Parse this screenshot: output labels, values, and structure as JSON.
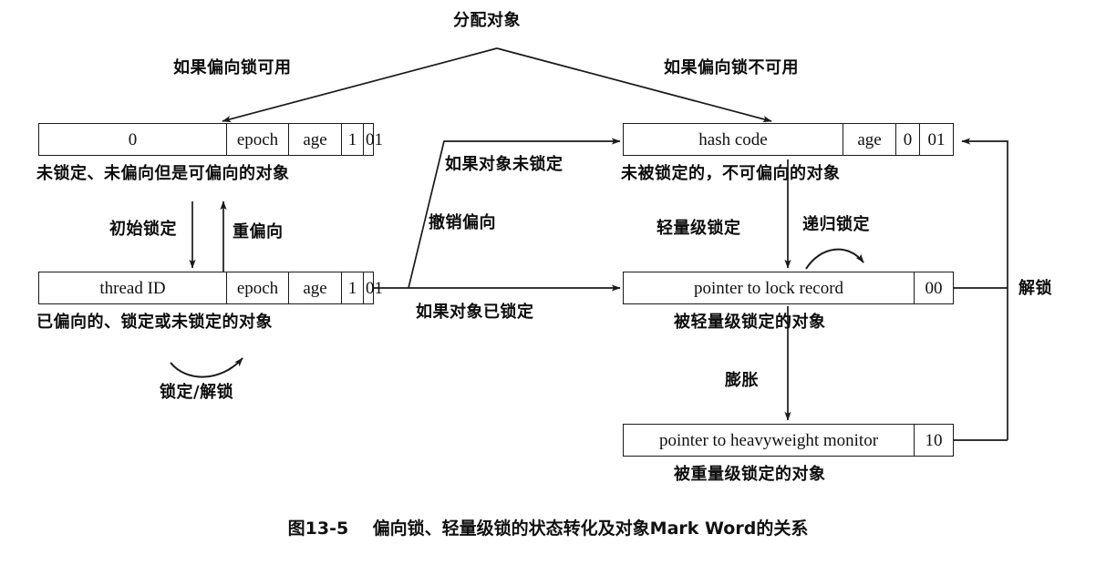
{
  "figure": {
    "caption": "图13-5    偏向锁、轻量级锁的状态转化及对象Mark Word的关系",
    "stroke_color": "#1a1a1a",
    "text_color": "#0d0d0d",
    "background": "#ffffff"
  },
  "boxes": {
    "biasable": {
      "id": "unlocked-biasable",
      "cells": [
        "0",
        "epoch",
        "age",
        "1",
        "01"
      ],
      "caption": "未锁定、未偏向但是可偏向的对象"
    },
    "biased": {
      "id": "biased-object",
      "cells": [
        "thread ID",
        "epoch",
        "age",
        "1",
        "01"
      ],
      "caption": "已偏向的、锁定或未锁定的对象"
    },
    "hashcode": {
      "id": "unlocked-non-biasable",
      "cells": [
        "hash code",
        "age",
        "0",
        "01"
      ],
      "caption": "未被锁定的，不可偏向的对象"
    },
    "lightweight": {
      "id": "lightweight-locked",
      "cells": [
        "pointer to lock record",
        "00"
      ],
      "caption": "被轻量级锁定的对象"
    },
    "heavyweight": {
      "id": "heavyweight-locked",
      "cells": [
        "pointer to heavyweight monitor",
        "10"
      ],
      "caption": "被重量级锁定的对象"
    }
  },
  "edges": {
    "allocate": "分配对象",
    "bias_available": "如果偏向锁可用",
    "bias_unavailable": "如果偏向锁不可用",
    "initial_lock": "初始锁定",
    "rebias": "重偏向",
    "lock_unlock": "锁定/解锁",
    "object_not_locked": "如果对象未锁定",
    "revoke_bias": "撤销偏向",
    "object_locked": "如果对象已锁定",
    "lightweight_lock": "轻量级锁定",
    "recursive_lock": "递归锁定",
    "inflate": "膨胀",
    "unlock": "解锁"
  }
}
